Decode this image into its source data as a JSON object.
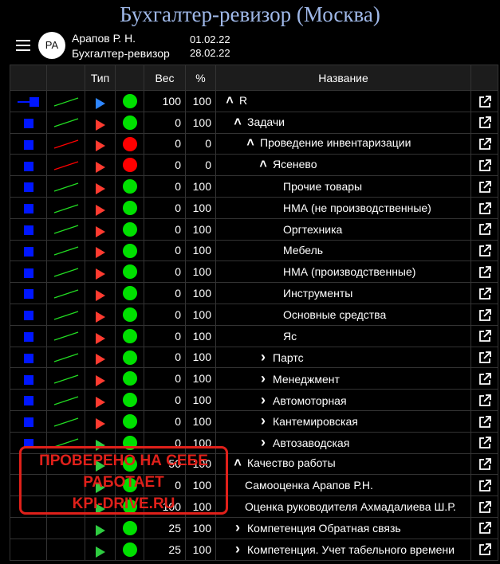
{
  "header": {
    "title": "Бухгалтер-ревизор (Москва)"
  },
  "user": {
    "initials": "РА",
    "name": "Арапов Р. Н.",
    "role": "Бухгалтер-ревизор",
    "date_from": "01.02.22",
    "date_to": "28.02.22"
  },
  "table": {
    "columns": [
      "",
      "",
      "Тип",
      "",
      "Вес",
      "%",
      "Название",
      ""
    ],
    "rows": [
      {
        "indent": 0,
        "chev": "up",
        "name": "R",
        "weight": "100",
        "pct": "100",
        "tri": "blue",
        "dot": "green",
        "trend": "green",
        "block": "bar"
      },
      {
        "indent": 1,
        "chev": "up",
        "name": "Задачи",
        "weight": "0",
        "pct": "100",
        "tri": "red",
        "dot": "green",
        "trend": "green",
        "block": "sq"
      },
      {
        "indent": 2,
        "chev": "up",
        "name": "Проведение инвентаризации",
        "weight": "0",
        "pct": "0",
        "tri": "red",
        "dot": "red",
        "trend": "red",
        "block": "sq"
      },
      {
        "indent": 3,
        "chev": "up",
        "name": "Ясенево",
        "weight": "0",
        "pct": "0",
        "tri": "red",
        "dot": "red",
        "trend": "red",
        "block": "sq"
      },
      {
        "indent": 4,
        "chev": "",
        "name": "Прочие товары",
        "weight": "0",
        "pct": "100",
        "tri": "red",
        "dot": "green",
        "trend": "green",
        "block": "sq"
      },
      {
        "indent": 4,
        "chev": "",
        "name": "НМА (не производственные)",
        "weight": "0",
        "pct": "100",
        "tri": "red",
        "dot": "green",
        "trend": "green",
        "block": "sq"
      },
      {
        "indent": 4,
        "chev": "",
        "name": "Оргтехника",
        "weight": "0",
        "pct": "100",
        "tri": "red",
        "dot": "green",
        "trend": "green",
        "block": "sq"
      },
      {
        "indent": 4,
        "chev": "",
        "name": "Мебель",
        "weight": "0",
        "pct": "100",
        "tri": "red",
        "dot": "green",
        "trend": "green",
        "block": "sq"
      },
      {
        "indent": 4,
        "chev": "",
        "name": "НМА (производственные)",
        "weight": "0",
        "pct": "100",
        "tri": "red",
        "dot": "green",
        "trend": "green",
        "block": "sq"
      },
      {
        "indent": 4,
        "chev": "",
        "name": "Инструменты",
        "weight": "0",
        "pct": "100",
        "tri": "red",
        "dot": "green",
        "trend": "green",
        "block": "sq"
      },
      {
        "indent": 4,
        "chev": "",
        "name": "Основные средства",
        "weight": "0",
        "pct": "100",
        "tri": "red",
        "dot": "green",
        "trend": "green",
        "block": "sq"
      },
      {
        "indent": 4,
        "chev": "",
        "name": "Яс",
        "weight": "0",
        "pct": "100",
        "tri": "red",
        "dot": "green",
        "trend": "green",
        "block": "sq"
      },
      {
        "indent": 3,
        "chev": "right",
        "name": "Партс",
        "weight": "0",
        "pct": "100",
        "tri": "red",
        "dot": "green",
        "trend": "green",
        "block": "sq"
      },
      {
        "indent": 3,
        "chev": "right",
        "name": "Менеджмент",
        "weight": "0",
        "pct": "100",
        "tri": "red",
        "dot": "green",
        "trend": "green",
        "block": "sq"
      },
      {
        "indent": 3,
        "chev": "right",
        "name": "Автомоторная",
        "weight": "0",
        "pct": "100",
        "tri": "red",
        "dot": "green",
        "trend": "green",
        "block": "sq"
      },
      {
        "indent": 3,
        "chev": "right",
        "name": "Кантемировская",
        "weight": "0",
        "pct": "100",
        "tri": "red",
        "dot": "green",
        "trend": "green",
        "block": "sq"
      },
      {
        "indent": 3,
        "chev": "right",
        "name": "Автозаводская",
        "weight": "0",
        "pct": "100",
        "tri": "green",
        "dot": "green",
        "trend": "green",
        "block": "sq"
      },
      {
        "indent": 1,
        "chev": "up",
        "name": "Качество работы",
        "weight": "50",
        "pct": "100",
        "tri": "green",
        "dot": "green",
        "trend": "",
        "block": ""
      },
      {
        "indent": 2,
        "chev": "",
        "name": "Самооценка Арапов Р.Н.",
        "weight": "0",
        "pct": "100",
        "tri": "green",
        "dot": "green",
        "trend": "",
        "block": ""
      },
      {
        "indent": 2,
        "chev": "",
        "name": "Оценка руководителя Ахмадалиева Ш.Р.",
        "weight": "100",
        "pct": "100",
        "tri": "green",
        "dot": "green",
        "trend": "",
        "block": ""
      },
      {
        "indent": 1,
        "chev": "right",
        "name": "Компетенция Обратная связь",
        "weight": "25",
        "pct": "100",
        "tri": "green",
        "dot": "green",
        "trend": "",
        "block": ""
      },
      {
        "indent": 1,
        "chev": "right",
        "name": "Компетенция. Учет табельного времени",
        "weight": "25",
        "pct": "100",
        "tri": "green",
        "dot": "green",
        "trend": "",
        "block": ""
      }
    ]
  },
  "stamp": {
    "line1": "ПРОВЕРЕНО НА СЕБЕ",
    "line2": "РАБОТАЕТ",
    "line3": "KPI-DRIVE.RU"
  },
  "colors": {
    "blue": "#0016ff",
    "green": "#00e000",
    "red": "#ff0000",
    "stamp": "#e0201a"
  }
}
